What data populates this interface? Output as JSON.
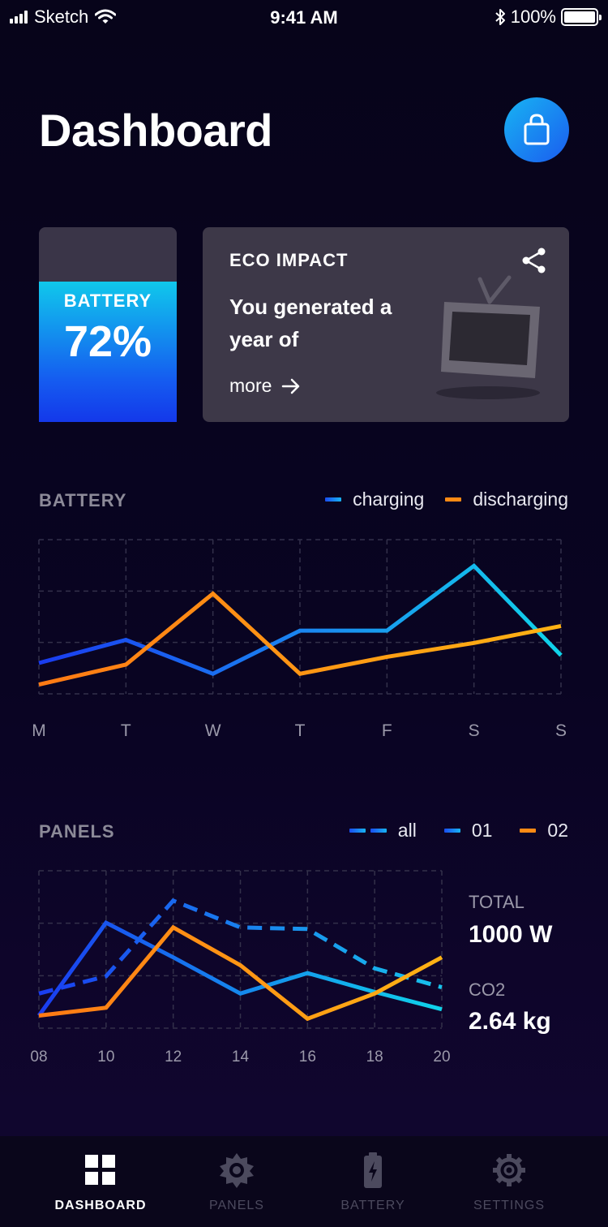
{
  "status_bar": {
    "carrier": "Sketch",
    "time": "9:41 AM",
    "battery": "100%"
  },
  "header": {
    "title": "Dashboard"
  },
  "battery_card": {
    "label": "BATTERY",
    "value": "72%",
    "level": 0.72
  },
  "eco_card": {
    "title": "ECO IMPACT",
    "text": "You generated a year of",
    "more": "more"
  },
  "battery_chart": {
    "title": "BATTERY",
    "legend": [
      {
        "label": "charging",
        "color": "#1a6ef0"
      },
      {
        "label": "discharging",
        "color": "#ff8a14"
      }
    ]
  },
  "panels_chart": {
    "title": "PANELS",
    "legend": [
      {
        "label": "all",
        "color": "#18b4f2"
      },
      {
        "label": "01",
        "color": "#1a6ef0"
      },
      {
        "label": "02",
        "color": "#ff8a14"
      }
    ]
  },
  "stats": {
    "total_label": "TOTAL",
    "total_value": "1000 W",
    "co2_label": "CO2",
    "co2_value": "2.64 kg"
  },
  "tabs": [
    {
      "label": "DASHBOARD",
      "icon": "grid-icon",
      "active": true
    },
    {
      "label": "PANELS",
      "icon": "sun-icon",
      "active": false
    },
    {
      "label": "BATTERY",
      "icon": "battery-icon",
      "active": false
    },
    {
      "label": "SETTINGS",
      "icon": "gear-icon",
      "active": false
    }
  ],
  "chart_data": [
    {
      "type": "line",
      "title": "BATTERY",
      "categories": [
        "M",
        "T",
        "W",
        "T",
        "F",
        "S",
        "S"
      ],
      "ylim": [
        0,
        100
      ],
      "grid": true,
      "legend": "top-right",
      "series": [
        {
          "name": "charging",
          "values": [
            20,
            35,
            13,
            41,
            41,
            83,
            25
          ]
        },
        {
          "name": "discharging",
          "values": [
            6,
            19,
            65,
            13,
            24,
            33,
            44
          ]
        }
      ]
    },
    {
      "type": "line",
      "categories": [
        "08",
        "10",
        "12",
        "14",
        "16",
        "18",
        "20"
      ],
      "ylim": [
        0,
        100
      ],
      "grid": true,
      "legend": "top-right",
      "series": [
        {
          "name": "all",
          "values": [
            22,
            33,
            81,
            64,
            63,
            38,
            26
          ],
          "style": "dashed"
        },
        {
          "name": "01",
          "values": [
            8,
            67,
            45,
            22,
            35,
            23,
            12
          ]
        },
        {
          "name": "02",
          "values": [
            8,
            13,
            64,
            40,
            6,
            22,
            45
          ]
        }
      ]
    }
  ]
}
